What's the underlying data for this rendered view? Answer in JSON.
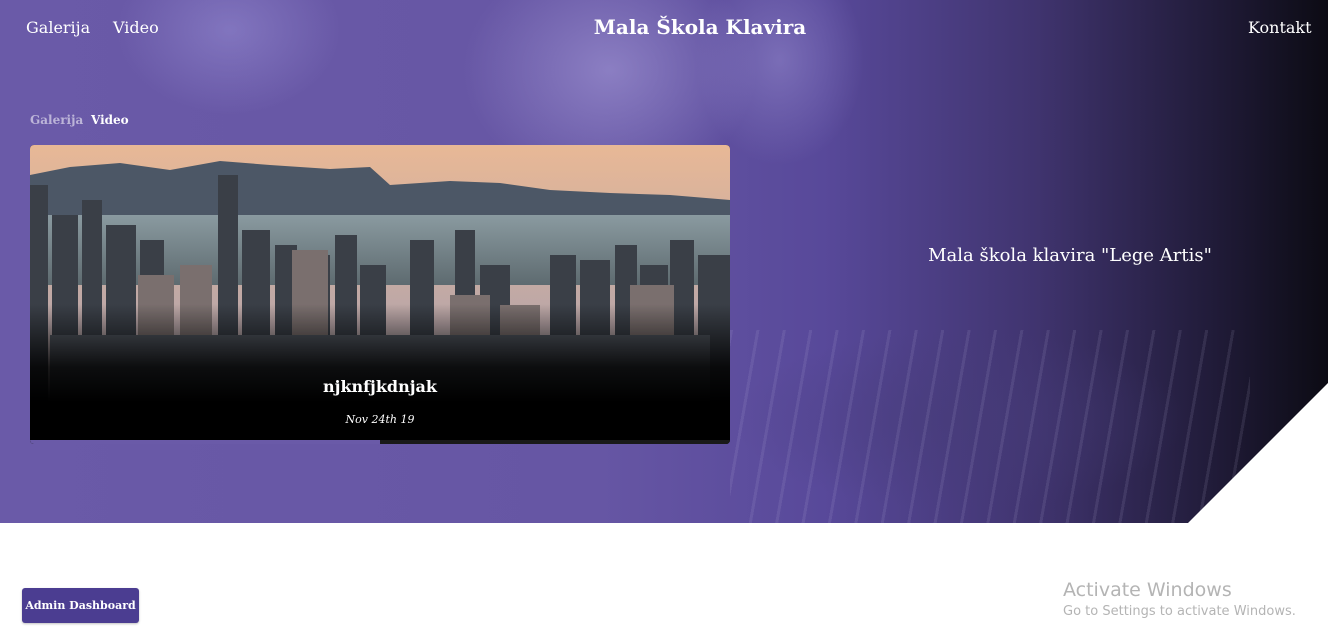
{
  "nav": {
    "left_links": [
      "Galerija",
      "Video"
    ],
    "site_title": "Mala Škola Klavira",
    "right_link": "Kontakt"
  },
  "breadcrumb": {
    "items": [
      "Galerija",
      "Video"
    ],
    "active_index": 1
  },
  "video_card": {
    "title": "njknfjkdnjak",
    "date": "Nov 24th 19",
    "progress_fraction": 0.5
  },
  "hero": {
    "tagline": "Mala škola klavira \"Lege Artis\""
  },
  "admin_button": {
    "label": "Admin Dashboard"
  },
  "windows_watermark": {
    "title": "Activate Windows",
    "subtitle": "Go to Settings to activate Windows."
  },
  "colors": {
    "accent": "#4b3d91",
    "hero_purple": "#6a5aa8"
  },
  "icons": {}
}
